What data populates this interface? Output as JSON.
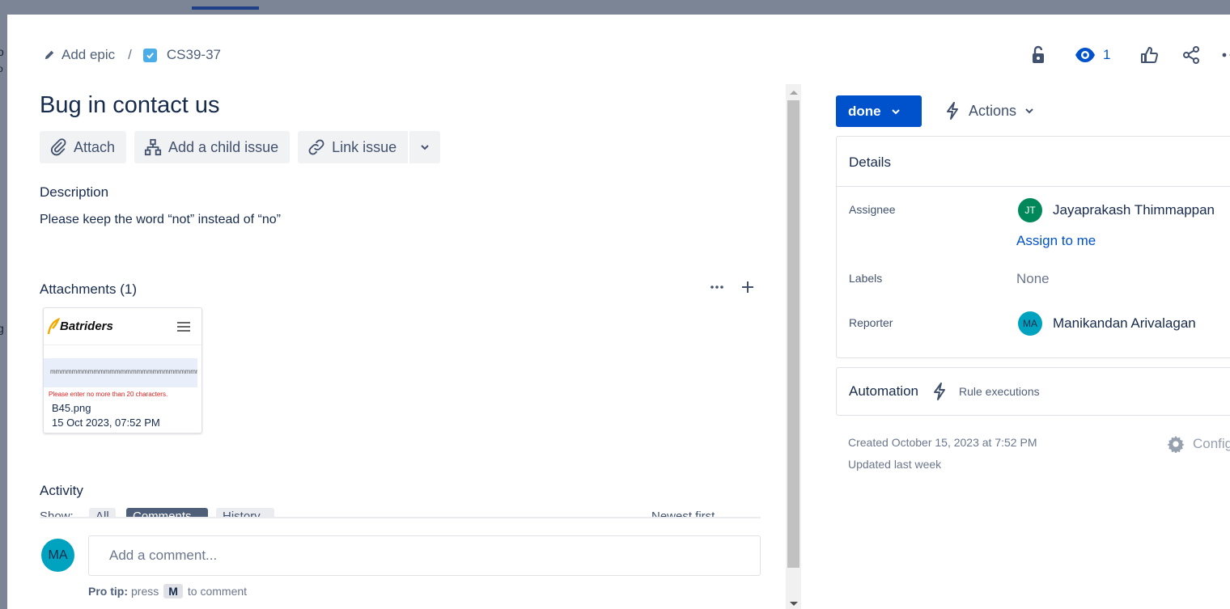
{
  "background": {
    "fragments": [
      "o",
      "o",
      "g"
    ]
  },
  "breadcrumb": {
    "epic_label": "Add epic",
    "separator": "/",
    "issue_key": "CS39-37"
  },
  "header_actions": {
    "watch_count": "1"
  },
  "issue": {
    "title": "Bug in contact us",
    "buttons": {
      "attach": "Attach",
      "add_child": "Add a child issue",
      "link_issue": "Link issue"
    },
    "description_heading": "Description",
    "description": "Please keep the word “not” instead of “no”"
  },
  "attachments": {
    "heading": "Attachments (1)",
    "items": [
      {
        "preview_brand": "Batriders",
        "preview_field_text": "mmmmmmmmmmmmmmmmmmmmmmmmmmmmmm",
        "preview_error": "Please enter no more than 20 characters.",
        "filename": "B45.png",
        "date": "15 Oct 2023, 07:52 PM"
      }
    ]
  },
  "activity": {
    "heading": "Activity",
    "filters": [
      "Show:",
      "All",
      "Comments",
      "History",
      "Newest first"
    ],
    "comment_placeholder": "Add a comment...",
    "commenter_initials": "MA",
    "protip_label": "Pro tip:",
    "protip_press": "press",
    "protip_key": "M",
    "protip_suffix": "to comment"
  },
  "status": {
    "label": "done"
  },
  "actions": {
    "label": "Actions"
  },
  "details": {
    "heading": "Details",
    "assignee_label": "Assignee",
    "assignee_name": "Jayaprakash Thimmappan",
    "assignee_initials": "JT",
    "assign_to_me": "Assign to me",
    "labels_label": "Labels",
    "labels_value": "None",
    "reporter_label": "Reporter",
    "reporter_name": "Manikandan Arivalagan",
    "reporter_initials": "MA"
  },
  "automation": {
    "heading": "Automation",
    "rule_executions": "Rule executions"
  },
  "meta": {
    "created": "Created October 15, 2023 at 7:52 PM",
    "updated": "Updated last week",
    "configure": "Configure"
  },
  "colors": {
    "primary": "#0052CC",
    "assignee_avatar": "#00875A",
    "reporter_avatar": "#00A3BF"
  }
}
